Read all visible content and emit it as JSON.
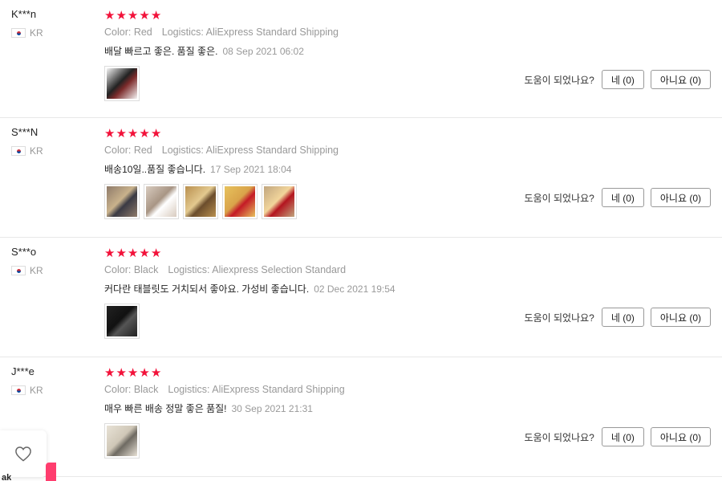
{
  "reviews": [
    {
      "user": "K***n",
      "country": "KR",
      "rating": 5,
      "color": "Color: Red",
      "logistics": "Logistics: AliExpress Standard Shipping",
      "text": "배달 빠르고 좋은. 품질 좋은.",
      "date": "08 Sep 2021 06:02",
      "thumbs": [
        {
          "icon": "product-photo",
          "colors": [
            "#f4f4f4",
            "#7a2a2a",
            "#222222"
          ]
        }
      ]
    },
    {
      "user": "S***N",
      "country": "KR",
      "rating": 5,
      "color": "Color: Red",
      "logistics": "Logistics: AliExpress Standard Shipping",
      "text": "배송10일..품질 좋습니다.",
      "date": "17 Sep 2021 18:04",
      "thumbs": [
        {
          "icon": "product-photo",
          "colors": [
            "#8f7b6a",
            "#3a3a44",
            "#c9b28c"
          ]
        },
        {
          "icon": "product-photo",
          "colors": [
            "#d8cbbf",
            "#ffffff",
            "#a89584"
          ]
        },
        {
          "icon": "product-photo",
          "colors": [
            "#b9904f",
            "#6b4d2c",
            "#e3c98f"
          ]
        },
        {
          "icon": "product-photo",
          "colors": [
            "#e7c25d",
            "#c41a26",
            "#d9a34a"
          ]
        },
        {
          "icon": "product-photo",
          "colors": [
            "#c0a57e",
            "#b3141f",
            "#f2d59b"
          ]
        }
      ]
    },
    {
      "user": "S***o",
      "country": "KR",
      "rating": 5,
      "color": "Color: Black",
      "logistics": "Logistics: Aliexpress Selection Standard",
      "text": "커다란 태블릿도 거치되서 좋아요. 가성비 좋습니다.",
      "date": "02 Dec 2021 19:54",
      "thumbs": [
        {
          "icon": "product-photo",
          "colors": [
            "#222222",
            "#555555",
            "#111111"
          ]
        }
      ]
    },
    {
      "user": "J***e",
      "country": "KR",
      "rating": 5,
      "color": "Color: Black",
      "logistics": "Logistics: AliExpress Standard Shipping",
      "text": "매우 빠른 배송 정말 좋은 품질!",
      "date": "30 Sep 2021 21:31",
      "thumbs": [
        {
          "icon": "product-photo",
          "colors": [
            "#e8e2d6",
            "#6e6a62",
            "#cfc7b7"
          ]
        }
      ]
    }
  ],
  "helpful": {
    "label": "도움이 되었나요?",
    "yes": "네 (0)",
    "no": "아니요 (0)"
  },
  "wishlist": {
    "icon": "heart-icon"
  },
  "bottom_fragment": "ak",
  "colors": {
    "star": "#f2123a",
    "accent_tab": "#ff3d6e"
  }
}
